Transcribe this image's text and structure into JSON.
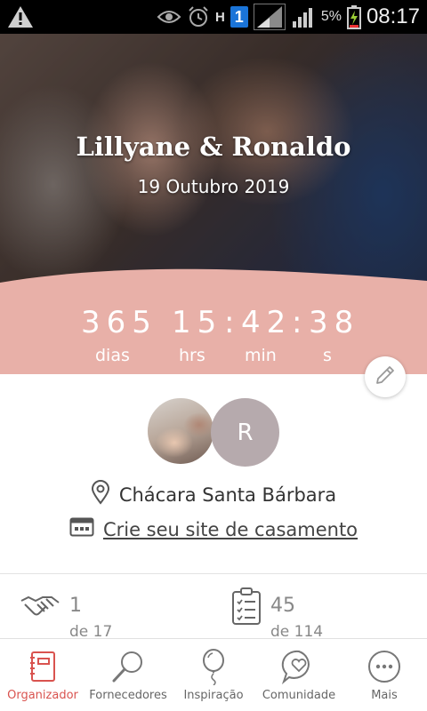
{
  "status_bar": {
    "h_label": "H",
    "sim_label": "1",
    "battery_percent": "5%",
    "time": "08:17",
    "icons": [
      "warning-icon",
      "eye-icon",
      "alarm-icon",
      "network-h-icon",
      "sim-1-icon",
      "signal-icon",
      "signal-icon",
      "battery-charging-icon"
    ]
  },
  "hero": {
    "title": "Lillyane & Ronaldo",
    "date": "19 Outubro 2019",
    "wave_color": "#e8b0a8"
  },
  "countdown": {
    "days": "365",
    "hours": "15",
    "minutes": "42",
    "seconds": "38",
    "days_label": "dias",
    "hours_label": "hrs",
    "minutes_label": "min",
    "seconds_label": "s"
  },
  "profile": {
    "avatar_initial": "R",
    "location": "Chácara Santa Bárbara",
    "site_link": "Crie seu site de casamento"
  },
  "stats": {
    "vendors_value": "1",
    "vendors_sub": "de 17",
    "tasks_value": "45",
    "tasks_sub": "de 114"
  },
  "bottom_nav": {
    "items": [
      {
        "label": "Organizador",
        "icon": "planner-icon",
        "active": true
      },
      {
        "label": "Fornecedores",
        "icon": "search-icon",
        "active": false
      },
      {
        "label": "Inspiração",
        "icon": "balloon-icon",
        "active": false
      },
      {
        "label": "Comunidade",
        "icon": "chat-heart-icon",
        "active": false
      },
      {
        "label": "Mais",
        "icon": "more-icon",
        "active": false
      }
    ]
  },
  "colors": {
    "accent": "#d9534f",
    "wave": "#e8b0a8",
    "avatar_bg": "#b6aaad"
  }
}
